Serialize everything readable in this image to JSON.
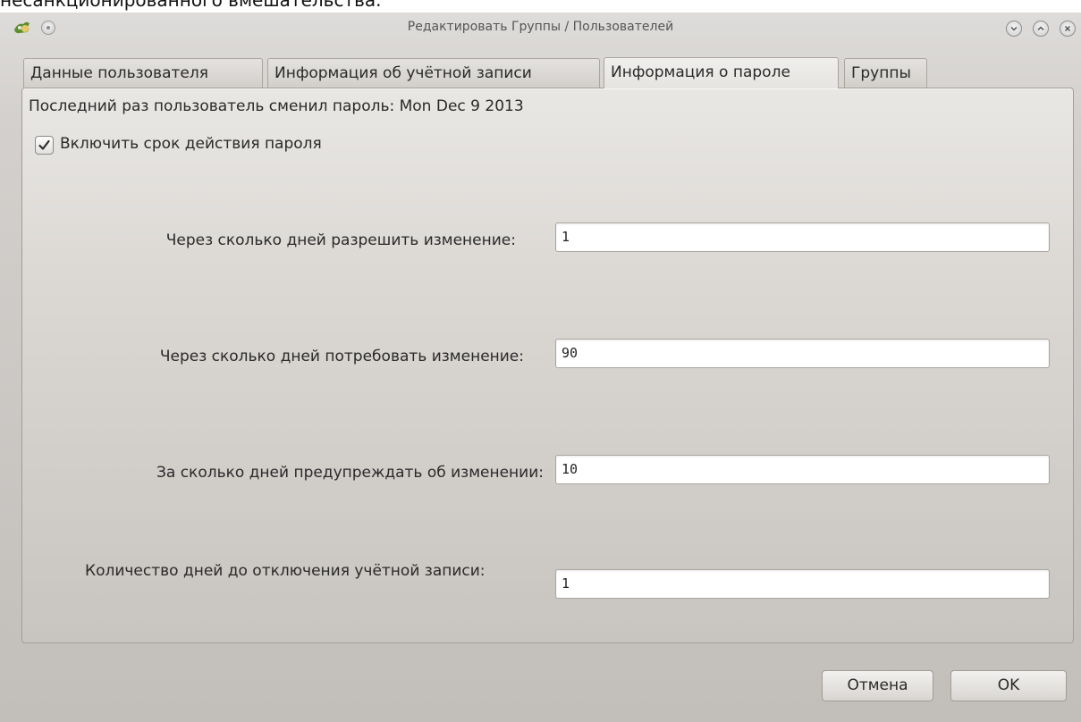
{
  "background_caption": "несанкционированного вмешательства.",
  "window": {
    "title": "Редактировать Группы / Пользователей"
  },
  "tabs": [
    {
      "label": "Данные пользователя",
      "active": false
    },
    {
      "label": "Информация об учётной записи",
      "active": false
    },
    {
      "label": "Информация о пароле",
      "active": true
    },
    {
      "label": "Группы",
      "active": false
    }
  ],
  "panel": {
    "last_change": "Последний раз пользователь сменил пароль: Mon Dec 9 2013",
    "expiry_checkbox": {
      "label": "Включить срок действия пароля",
      "checked": true
    },
    "fields": [
      {
        "label": "Через сколько дней разрешить изменение:",
        "value": "1"
      },
      {
        "label": "Через сколько дней потребовать изменение:",
        "value": "90"
      },
      {
        "label": "За сколько дней предупреждать об изменении:",
        "value": "10"
      },
      {
        "label": "Количество дней до отключения учётной записи:",
        "value": "1"
      }
    ]
  },
  "buttons": {
    "cancel": "Отмена",
    "ok": "OK"
  },
  "icons": {
    "app": "user-group-icon",
    "menu": "context-menu-icon",
    "minimize": "minimize-icon",
    "maximize": "maximize-icon",
    "close": "close-icon"
  }
}
